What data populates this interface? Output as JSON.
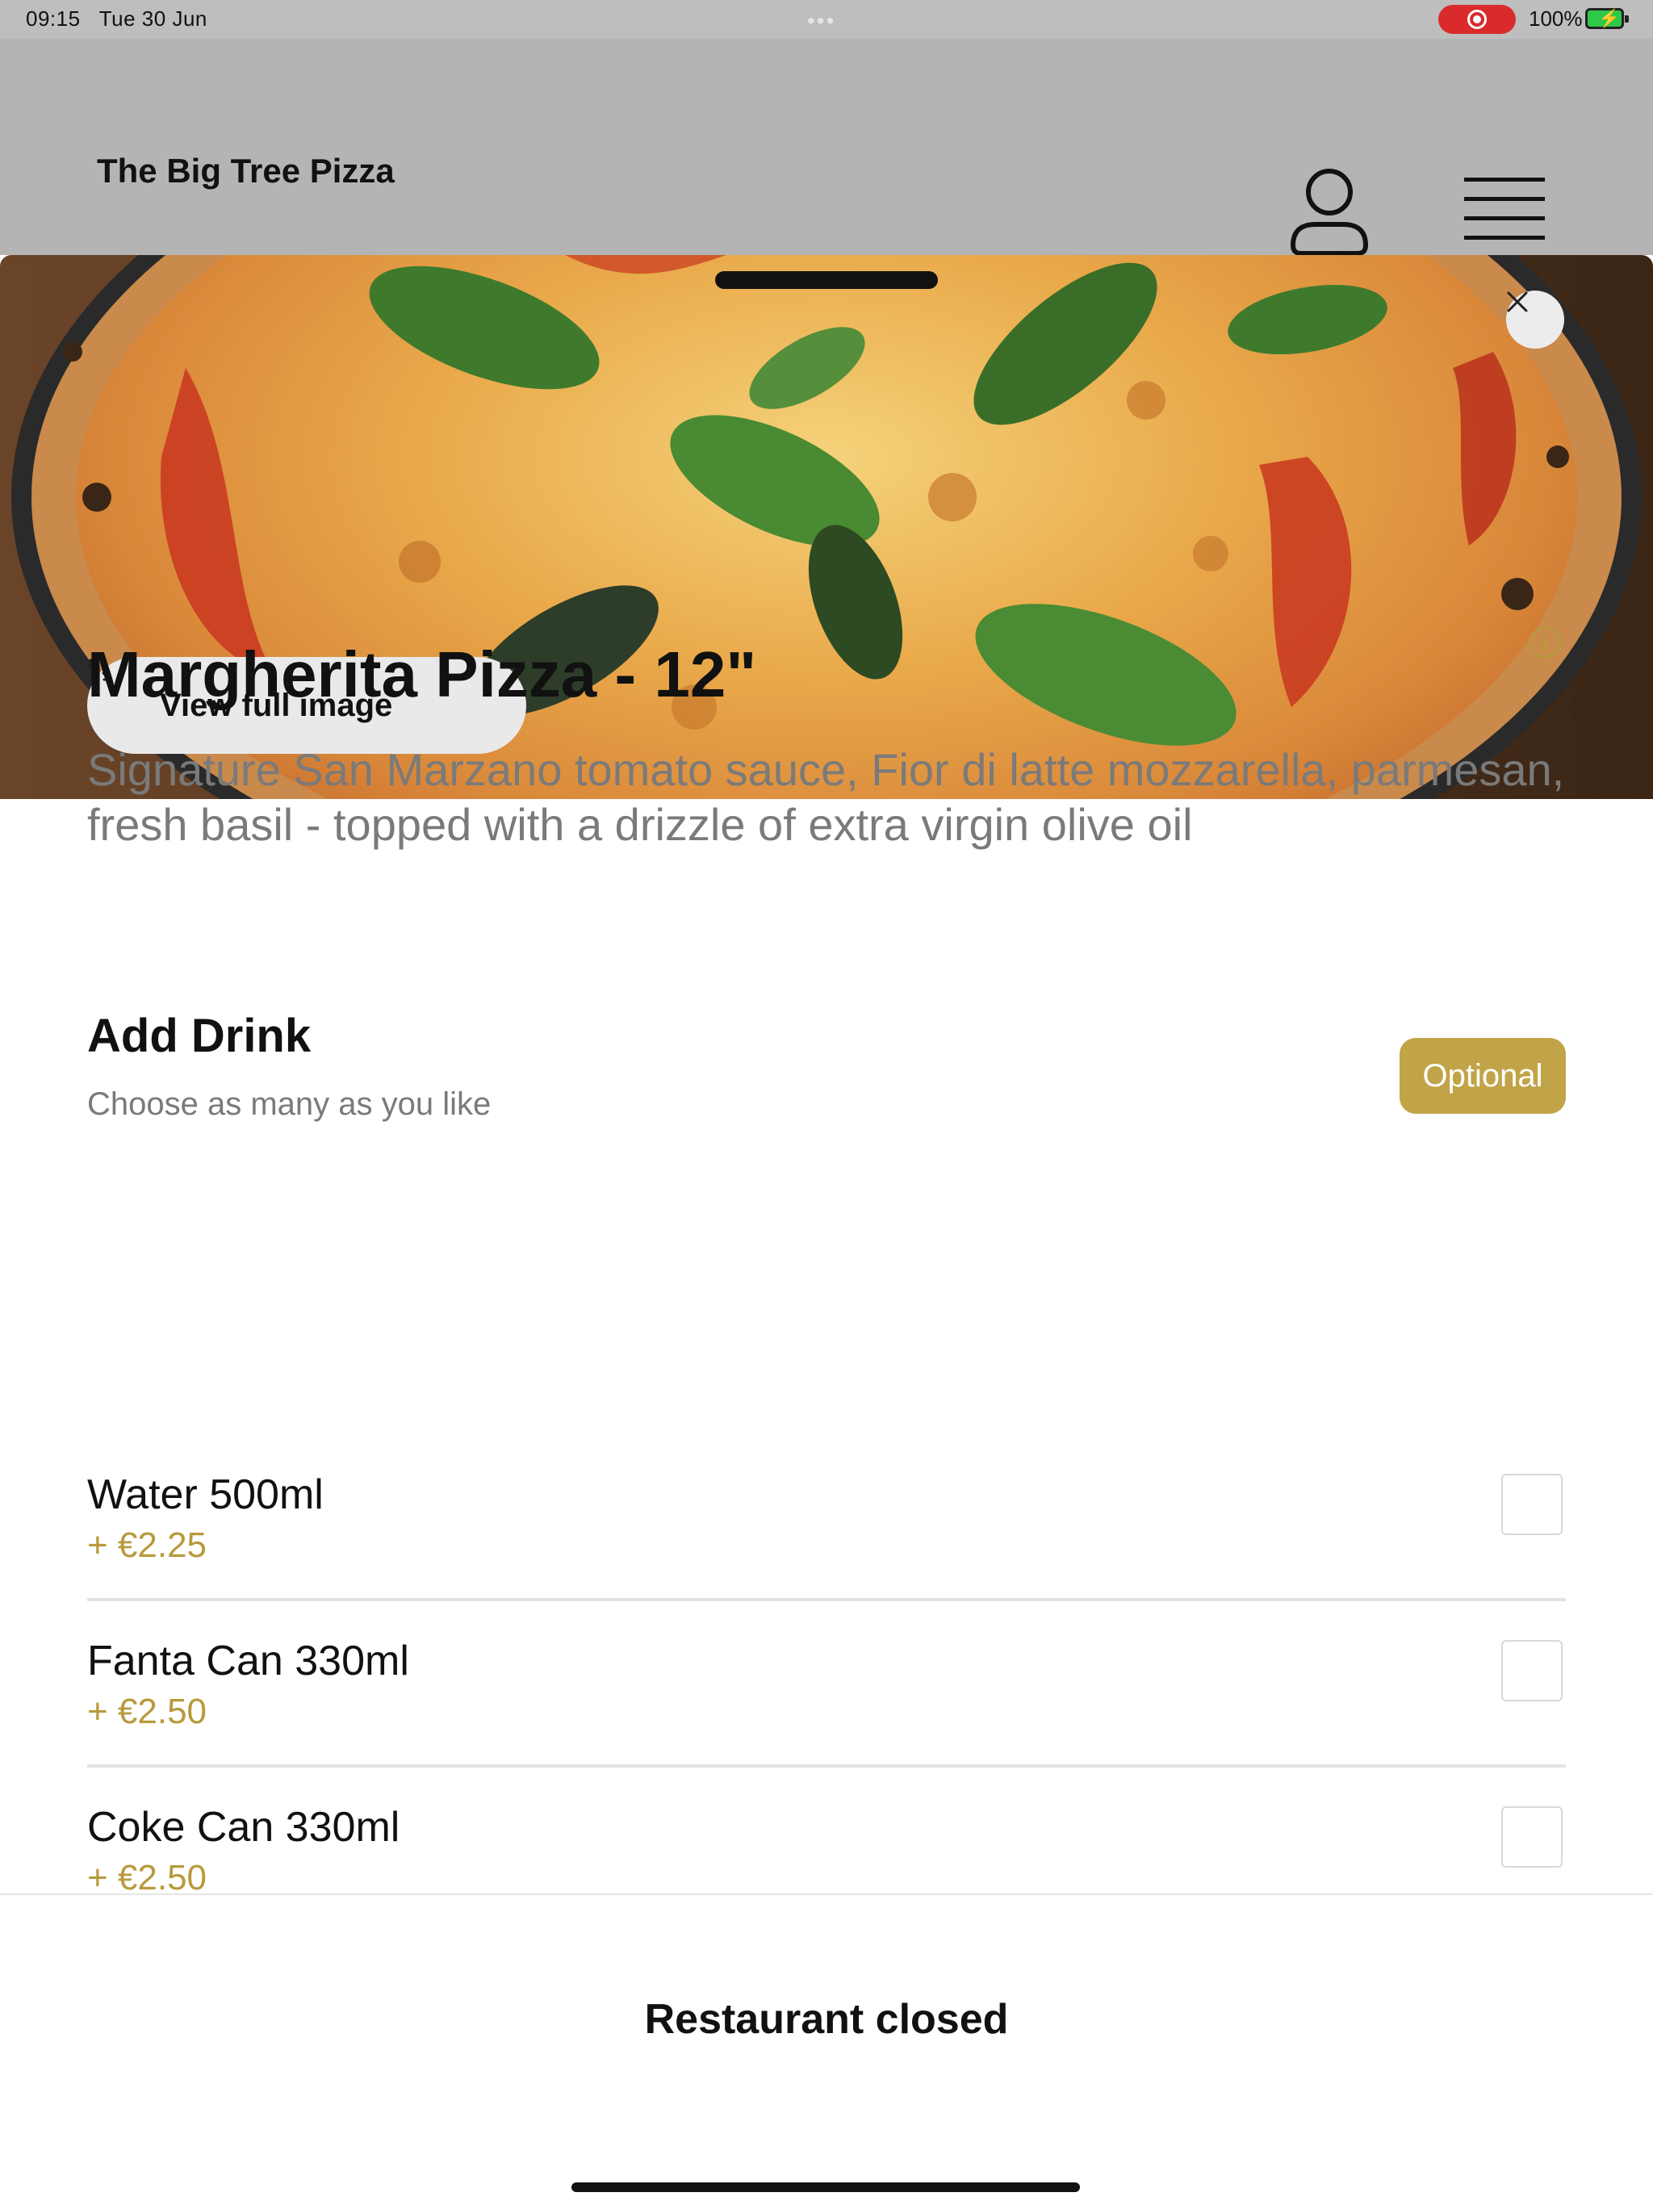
{
  "status_bar": {
    "time": "09:15",
    "date": "Tue 30 Jun",
    "battery": "100%"
  },
  "header": {
    "brand": "The Big Tree Pizza",
    "account_icon": "person-icon",
    "menu_icon": "hamburger-menu-icon"
  },
  "hero": {
    "view_full_label": "View full image",
    "expand_icon": "expand-arrows-icon",
    "close_icon": "close-icon"
  },
  "item": {
    "title": "Margherita Pizza - 12\"",
    "description": "Signature San Marzano tomato sauce, Fior di latte mozzarella, parmesan, fresh basil - topped with a drizzle of extra virgin olive oil",
    "info_icon": "info-icon"
  },
  "drink_section": {
    "title": "Add Drink",
    "subtitle": "Choose as many as you like",
    "badge": "Optional",
    "options": [
      {
        "name": "Water 500ml",
        "price": "+ €2.25",
        "checked": false
      },
      {
        "name": "Fanta Can 330ml",
        "price": "+ €2.50",
        "checked": false
      },
      {
        "name": "Coke Can 330ml",
        "price": "+ €2.50",
        "checked": false
      }
    ]
  },
  "footer": {
    "status": "Restaurant closed"
  },
  "colors": {
    "accent_gold": "#c1a448",
    "price_gold": "#b89a3c",
    "recording_red": "#d92b2b",
    "battery_green": "#2ec94b"
  }
}
